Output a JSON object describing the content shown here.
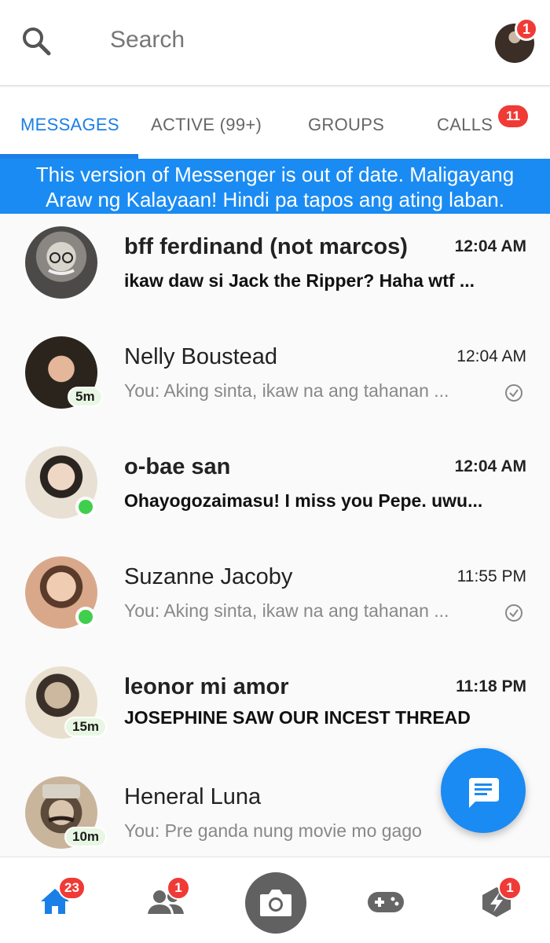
{
  "header": {
    "search_placeholder": "Search",
    "profile_badge": "1"
  },
  "tabs": [
    {
      "label": "MESSAGES",
      "active": true
    },
    {
      "label": "ACTIVE (99+)",
      "active": false
    },
    {
      "label": "GROUPS",
      "active": false
    },
    {
      "label": "CALLS",
      "active": false,
      "badge": "11"
    }
  ],
  "banner": {
    "line1": "This version of Messenger is out of date. Maligayang",
    "line2": "Araw ng Kalayaan! Hindi pa tapos ang ating laban."
  },
  "conversations": [
    {
      "name": "bff ferdinand (not marcos)",
      "time": "12:04 AM",
      "preview": "ikaw daw si Jack the Ripper? Haha wtf  ...",
      "unread": true,
      "status": "",
      "seen": false
    },
    {
      "name": "Nelly Boustead",
      "time": "12:04 AM",
      "preview": "You: Aking sinta, ikaw na ang tahanan ...",
      "unread": false,
      "status": "5m",
      "seen": true
    },
    {
      "name": "o-bae san",
      "time": "12:04 AM",
      "preview": "Ohayogozaimasu! I miss you Pepe. uwu...",
      "unread": true,
      "status": "online",
      "seen": false
    },
    {
      "name": "Suzanne Jacoby",
      "time": "11:55 PM",
      "preview": "You: Aking sinta, ikaw na ang tahanan ...",
      "unread": false,
      "status": "online",
      "seen": true
    },
    {
      "name": "leonor mi amor",
      "time": "11:18 PM",
      "preview": "JOSEPHINE SAW OUR INCEST THREAD",
      "unread": true,
      "status": "15m",
      "seen": false
    },
    {
      "name": "Heneral Luna",
      "time": "",
      "preview": "You: Pre ganda nung movie mo gago",
      "unread": false,
      "status": "10m",
      "seen": false
    }
  ],
  "bottom_nav": {
    "home_badge": "23",
    "people_badge": "1",
    "discover_badge": "1"
  },
  "colors": {
    "accent": "#1a8bf2",
    "badge": "#f03a36",
    "online": "#3fcf4d"
  }
}
